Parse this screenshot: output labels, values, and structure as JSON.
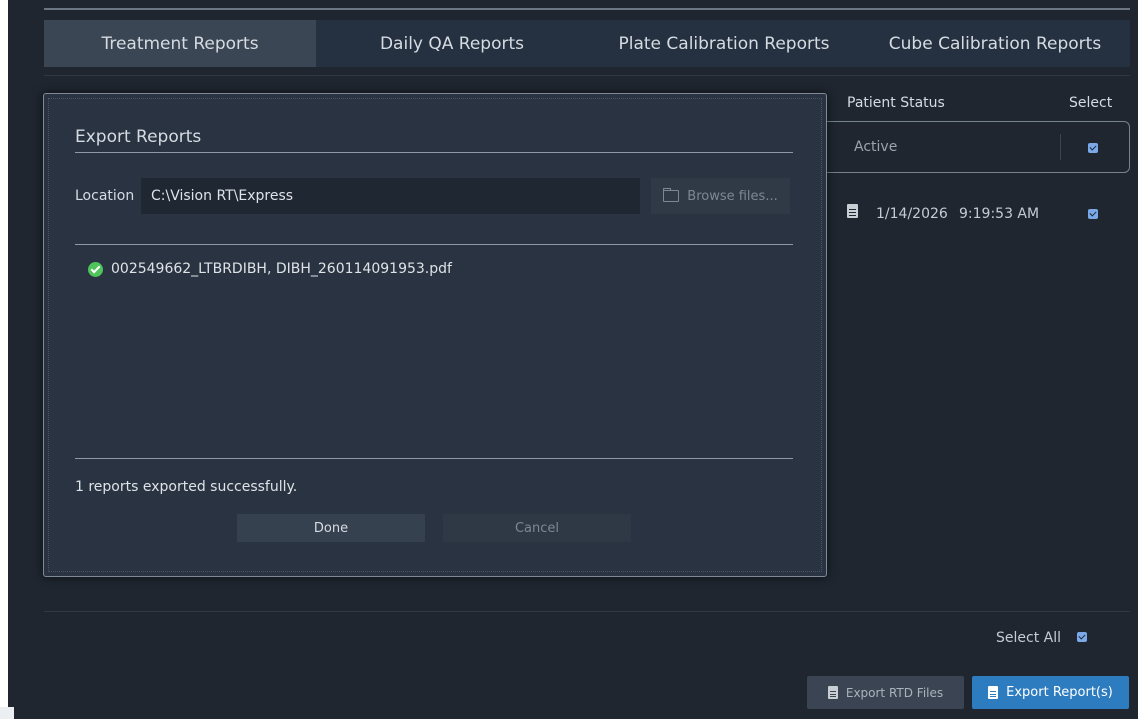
{
  "tabs": [
    {
      "label": "Treatment Reports",
      "active": true
    },
    {
      "label": "Daily QA Reports",
      "active": false
    },
    {
      "label": "Plate Calibration Reports",
      "active": false
    },
    {
      "label": "Cube Calibration Reports",
      "active": false
    }
  ],
  "table": {
    "patient_status_header": "Patient Status",
    "select_header": "Select",
    "status_value": "Active",
    "status_checked": true,
    "rows": [
      {
        "date": "1/14/2026",
        "time": "9:19:53 AM",
        "checked": true
      }
    ]
  },
  "footer": {
    "select_all_label": "Select All",
    "select_all_checked": true,
    "export_rtd_label": "Export RTD Files",
    "export_reports_label": "Export Report(s)"
  },
  "modal": {
    "title": "Export Reports",
    "location_label": "Location",
    "location_value": "C:\\Vision RT\\Express",
    "browse_label": "Browse files...",
    "files": [
      {
        "name": "002549662_LTBRDIBH, DIBH_260114091953.pdf",
        "status": "success"
      }
    ],
    "status_message": "1 reports exported successfully.",
    "done_label": "Done",
    "cancel_label": "Cancel"
  },
  "colors": {
    "background": "#1f2630",
    "active_tab": "#3b4654",
    "accent_blue": "#2e7cc0",
    "success_green": "#4ec45a"
  }
}
